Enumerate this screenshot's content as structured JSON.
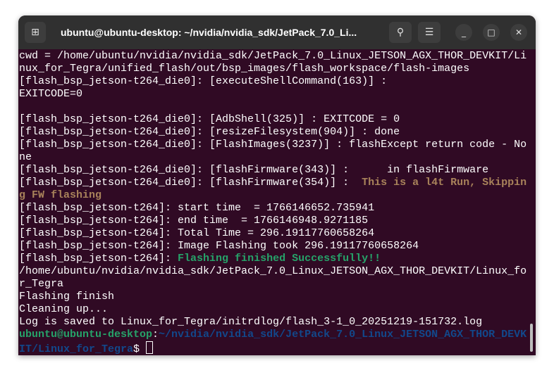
{
  "window": {
    "title": "ubuntu@ubuntu-desktop: ~/nvidia/nvidia_sdk/JetPack_7.0_Li...",
    "icons": {
      "new_tab": "new-tab-icon",
      "search": "search-icon",
      "menu": "hamburger-menu-icon",
      "minimize": "minimize-icon",
      "maximize": "maximize-icon",
      "close": "close-icon"
    }
  },
  "colors": {
    "background": "#300a24",
    "titlebar": "#303030",
    "warning": "#a8825a",
    "success": "#26a269",
    "prompt_user": "#26a269",
    "prompt_path": "#12488b"
  },
  "terminal": {
    "lines": [
      [
        {
          "t": "cwd = /home/ubuntu/nvidia/nvidia_sdk/JetPack_7.0_Linux_JETSON_AGX_THOR_DEVKIT/Li"
        }
      ],
      [
        {
          "t": "nux_for_Tegra/unified_flash/out/bsp_images/flash_workspace/flash-images"
        }
      ],
      [
        {
          "t": "[flash_bsp_jetson-t264_die0]: [executeShellCommand(163)] :"
        }
      ],
      [
        {
          "t": "EXITCODE=0"
        }
      ],
      [
        {
          "t": ""
        }
      ],
      [
        {
          "t": "[flash_bsp_jetson-t264_die0]: [AdbShell(325)] : EXITCODE = 0"
        }
      ],
      [
        {
          "t": "[flash_bsp_jetson-t264_die0]: [resizeFilesystem(904)] : done"
        }
      ],
      [
        {
          "t": "[flash_bsp_jetson-t264_die0]: [FlashImages(3237)] : flashExcept return code - No"
        }
      ],
      [
        {
          "t": "ne"
        }
      ],
      [
        {
          "t": "[flash_bsp_jetson-t264_die0]: [flashFirmware(343)] :      in flashFirmware"
        }
      ],
      [
        {
          "t": "[flash_bsp_jetson-t264_die0]: [flashFirmware(354)] :  "
        },
        {
          "t": "This is a l4t Run, Skippin",
          "c": "warning"
        }
      ],
      [
        {
          "t": "g FW flashing",
          "c": "warning"
        }
      ],
      [
        {
          "t": "[flash_bsp_jetson-t264]: start time  = 1766146652.735941"
        }
      ],
      [
        {
          "t": "[flash_bsp_jetson-t264]: end time  = 1766146948.9271185"
        }
      ],
      [
        {
          "t": "[flash_bsp_jetson-t264]: Total Time = 296.19117760658264"
        }
      ],
      [
        {
          "t": "[flash_bsp_jetson-t264]: Image Flashing took 296.19117760658264"
        }
      ],
      [
        {
          "t": "[flash_bsp_jetson-t264]: "
        },
        {
          "t": "Flashing finished Successfully!!",
          "c": "success"
        }
      ],
      [
        {
          "t": "/home/ubuntu/nvidia/nvidia_sdk/JetPack_7.0_Linux_JETSON_AGX_THOR_DEVKIT/Linux_fo"
        }
      ],
      [
        {
          "t": "r_Tegra"
        }
      ],
      [
        {
          "t": "Flashing finish"
        }
      ],
      [
        {
          "t": "Cleaning up..."
        }
      ],
      [
        {
          "t": "Log is saved to Linux_for_Tegra/initrdlog/flash_3-1_0_20251219-151732.log"
        }
      ],
      [
        {
          "t": "ubuntu@ubuntu-desktop",
          "c": "prompt_user"
        },
        {
          "t": ":"
        },
        {
          "t": "~/nvidia/nvidia_sdk/JetPack_7.0_Linux_JETSON_AGX_THOR_DEVK",
          "c": "prompt_path"
        }
      ],
      [
        {
          "t": "IT/Linux_for_Tegra",
          "c": "prompt_path"
        },
        {
          "t": "$ "
        }
      ]
    ]
  }
}
